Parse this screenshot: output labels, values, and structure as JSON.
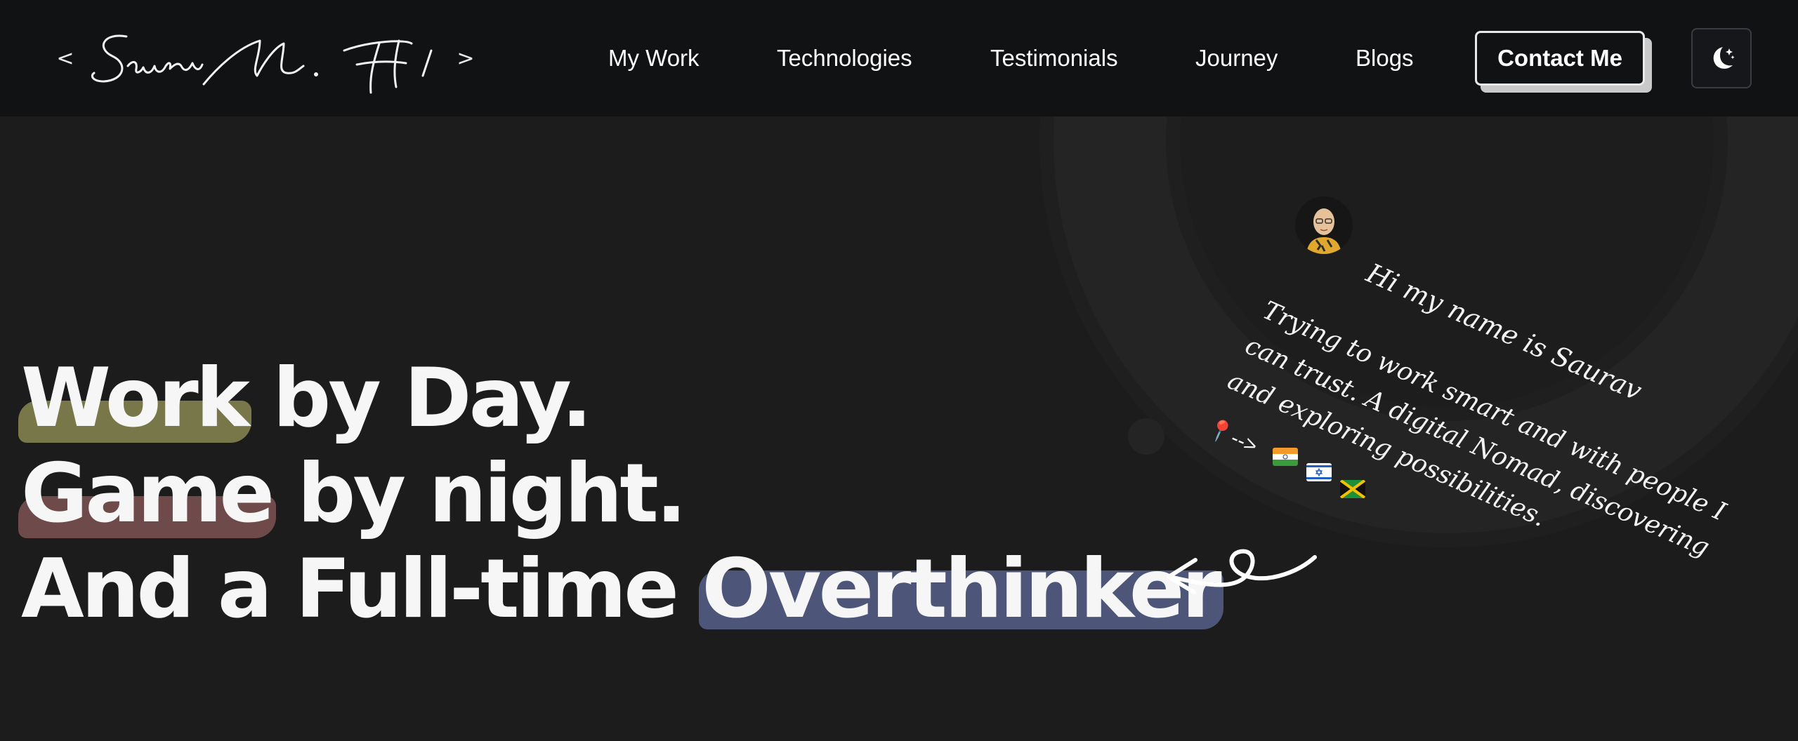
{
  "header": {
    "logo": {
      "left_bracket": "<",
      "signature": "Saurav M. H /",
      "right_bracket": ">"
    },
    "nav": [
      {
        "label": "My Work"
      },
      {
        "label": "Technologies"
      },
      {
        "label": "Testimonials"
      },
      {
        "label": "Journey"
      },
      {
        "label": "Blogs"
      }
    ],
    "contact_label": "Contact Me",
    "theme_toggle_icon": "moon-stars-icon"
  },
  "hero": {
    "line1": {
      "highlight": "Work",
      "rest": " by Day."
    },
    "line2": {
      "highlight": "Game",
      "rest": " by night."
    },
    "line3": {
      "rest": "And a Full-time ",
      "highlight": "Overthinker"
    }
  },
  "intro": {
    "greeting": "Hi my name is Saurav",
    "bio_lines": [
      "Trying to work smart and with people I",
      "can trust. A digital Nomad, discovering",
      "and exploring possibilities."
    ],
    "location_marker": "📍-->",
    "flags": [
      "india-flag",
      "israel-flag",
      "jamaica-flag"
    ]
  },
  "colors": {
    "header_bg": "#111214",
    "page_bg": "#1c1c1c",
    "highlight_work": "#787749",
    "highlight_game": "#6f4a4a",
    "highlight_overthinker": "#4d5578"
  }
}
